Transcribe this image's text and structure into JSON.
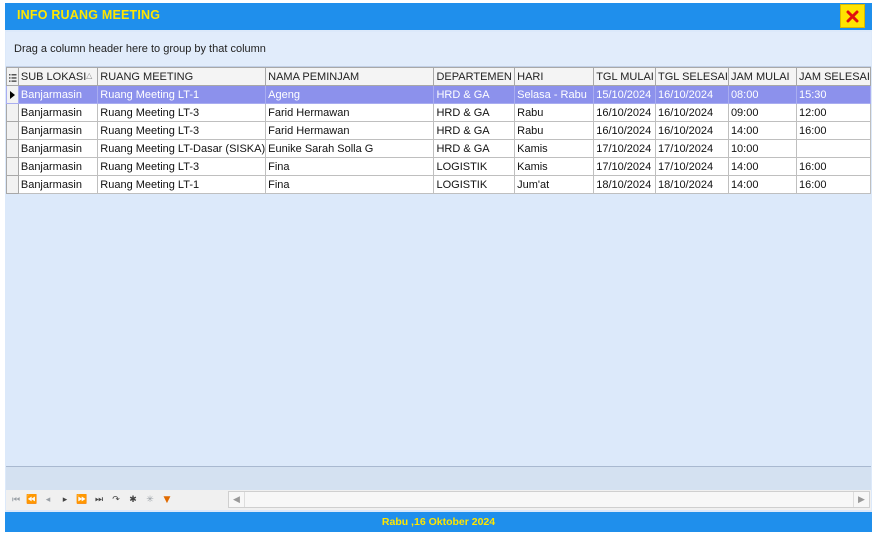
{
  "window": {
    "title": "INFO RUANG MEETING"
  },
  "grid": {
    "group_panel_text": "Drag a column header here to group by that column",
    "columns": [
      "SUB LOKASI",
      "RUANG MEETING",
      "NAMA PEMINJAM",
      "DEPARTEMEN",
      "HARI",
      "TGL MULAI",
      "TGL SELESAI",
      "JAM MULAI",
      "JAM SELESAI"
    ],
    "sorted_column": "SUB LOKASI",
    "sort_direction": "ascending",
    "rows": [
      [
        "Banjarmasin",
        "Ruang Meeting LT-1",
        "Ageng",
        "HRD & GA",
        "Selasa - Rabu",
        "15/10/2024",
        "16/10/2024",
        "08:00",
        "15:30"
      ],
      [
        "Banjarmasin",
        "Ruang Meeting LT-3",
        "Farid Hermawan",
        "HRD & GA",
        "Rabu",
        "16/10/2024",
        "16/10/2024",
        "09:00",
        "12:00"
      ],
      [
        "Banjarmasin",
        "Ruang Meeting LT-3",
        "Farid Hermawan",
        "HRD & GA",
        "Rabu",
        "16/10/2024",
        "16/10/2024",
        "14:00",
        "16:00"
      ],
      [
        "Banjarmasin",
        "Ruang Meeting LT-Dasar (SISKA)",
        "Eunike Sarah Solla G",
        "HRD & GA",
        "Kamis",
        "17/10/2024",
        "17/10/2024",
        "10:00",
        ""
      ],
      [
        "Banjarmasin",
        "Ruang Meeting LT-3",
        "Fina",
        "LOGISTIK",
        "Kamis",
        "17/10/2024",
        "17/10/2024",
        "14:00",
        "16:00"
      ],
      [
        "Banjarmasin",
        "Ruang Meeting LT-1",
        "Fina",
        "LOGISTIK",
        "Jum'at",
        "18/10/2024",
        "18/10/2024",
        "14:00",
        "16:00"
      ]
    ]
  },
  "navigator": {
    "buttons": [
      "first-page",
      "prev-page",
      "prev-record",
      "next-record",
      "next-page",
      "last-page",
      "refresh",
      "append",
      "delete",
      "filter"
    ]
  },
  "status": {
    "date_text": "Rabu ,16 Oktober 2024"
  },
  "colors": {
    "title_bar": "#1f8fec",
    "title_text": "#ffe600",
    "selected_row": "#8c91ec",
    "grid_background": "#dce9fa"
  }
}
